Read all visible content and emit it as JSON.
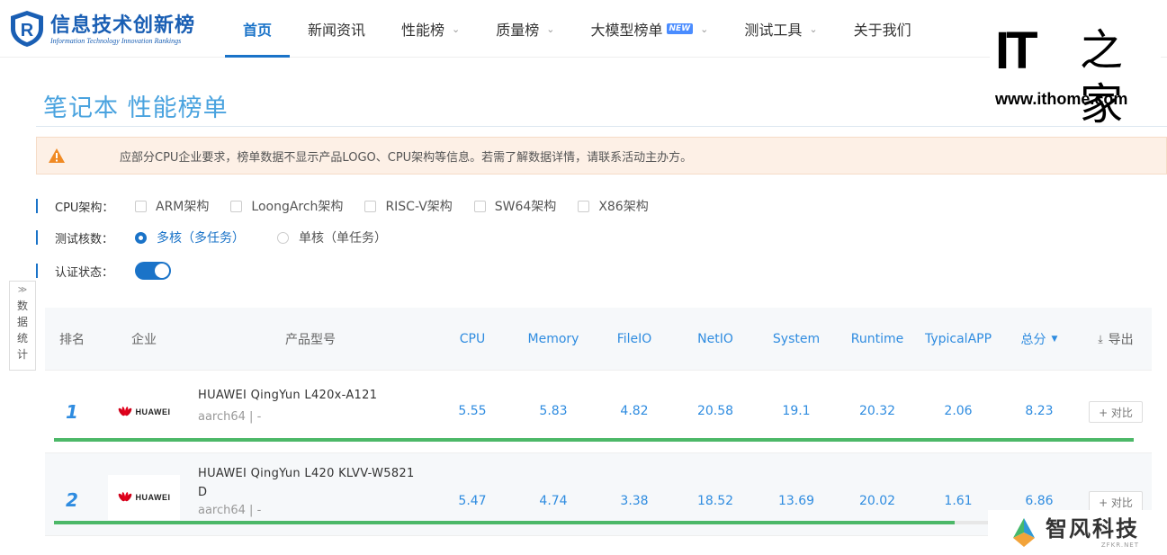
{
  "header": {
    "logo_cn": "信息技术创新榜",
    "logo_en": "Information Technology Innovation Rankings",
    "nav": [
      {
        "label": "首页",
        "active": true,
        "dropdown": false
      },
      {
        "label": "新闻资讯",
        "active": false,
        "dropdown": false
      },
      {
        "label": "性能榜",
        "active": false,
        "dropdown": true
      },
      {
        "label": "质量榜",
        "active": false,
        "dropdown": true
      },
      {
        "label": "大模型榜单",
        "active": false,
        "dropdown": true,
        "badge": "NEW"
      },
      {
        "label": "测试工具",
        "active": false,
        "dropdown": true
      },
      {
        "label": "关于我们",
        "active": false,
        "dropdown": false
      }
    ]
  },
  "watermark_ithome": {
    "mark": "IT",
    "home": "之家",
    "url": "www.ithome.com"
  },
  "page_title": "笔记本 性能榜单",
  "alert": {
    "text": "应部分CPU企业要求，榜单数据不显示产品LOGO、CPU架构等信息。若需了解数据详情，请联系活动主办方。"
  },
  "filters": {
    "cpu_label": "CPU架构：",
    "cpu_options": [
      "ARM架构",
      "LoongArch架构",
      "RISC-V架构",
      "SW64架构",
      "X86架构"
    ],
    "cores_label": "测试核数：",
    "cores_options": [
      {
        "label": "多核（多任务）",
        "selected": true
      },
      {
        "label": "单核（单任务）",
        "selected": false
      }
    ],
    "cert_label": "认证状态：",
    "cert_on": true
  },
  "side_tab": {
    "chevron": "»",
    "label": "数据统计"
  },
  "table": {
    "headers": {
      "rank": "排名",
      "company": "企业",
      "model": "产品型号",
      "cpu": "CPU",
      "memory": "Memory",
      "fileio": "FileIO",
      "netio": "NetIO",
      "system": "System",
      "runtime": "Runtime",
      "typicalapp": "TypicalAPP",
      "total": "总分",
      "export": "导出"
    },
    "compare_label": "+ 对比",
    "rows": [
      {
        "rank": "1",
        "brand": "HUAWEI",
        "model": "HUAWEI QingYun L420x-A121",
        "arch": "aarch64  | -",
        "cpu": "5.55",
        "memory": "5.83",
        "fileio": "4.82",
        "netio": "20.58",
        "system": "19.1",
        "runtime": "20.32",
        "typicalapp": "2.06",
        "total": "8.23",
        "progress": 1.0
      },
      {
        "rank": "2",
        "brand": "HUAWEI",
        "model": "HUAWEI QingYun L420 KLVV-W5821 D",
        "arch": "aarch64  | -",
        "cpu": "5.47",
        "memory": "4.74",
        "fileio": "3.38",
        "netio": "18.52",
        "system": "13.69",
        "runtime": "20.02",
        "typicalapp": "1.61",
        "total": "6.86",
        "progress": 0.834
      }
    ]
  },
  "watermark_zf": {
    "cn": "智风科技",
    "en": "ZFKR.NET"
  },
  "colors": {
    "accent": "#1a73c8",
    "metric": "#2f8ce0",
    "progress": "#4cb868",
    "alert_bg": "#fdf0e6",
    "warning": "#f08a24"
  }
}
